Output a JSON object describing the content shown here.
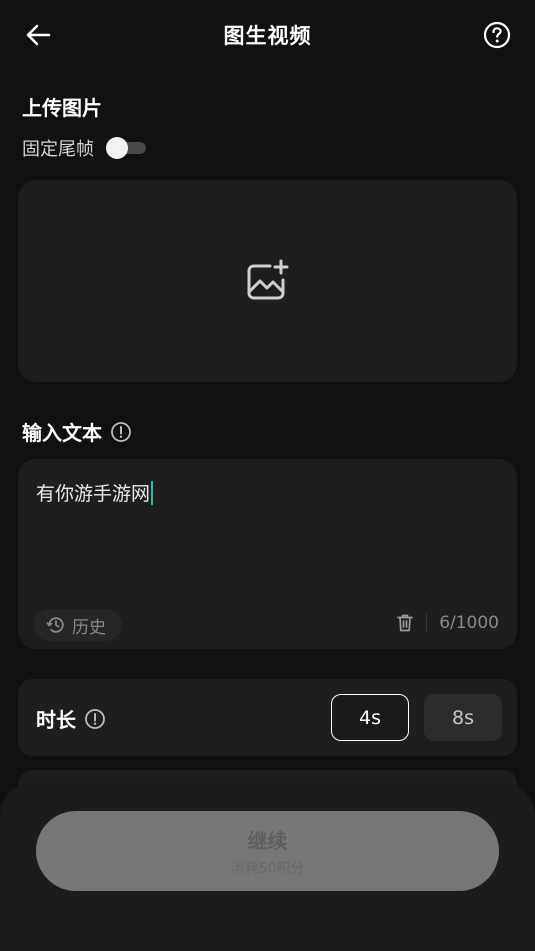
{
  "header": {
    "title": "图生视频",
    "back_icon": "arrow-left-icon",
    "help_icon": "question-circle-icon"
  },
  "upload": {
    "title": "上传图片",
    "fix_last_frame_label": "固定尾帧",
    "fix_last_frame_enabled": false,
    "add_image_icon": "image-plus-icon"
  },
  "text_input": {
    "title": "输入文本",
    "value": "有你游手游网",
    "history_label": "历史",
    "counter": "6/1000",
    "clear_icon": "trash-icon"
  },
  "duration": {
    "title": "时长",
    "options": [
      "4s",
      "8s"
    ],
    "selected": "4s"
  },
  "cta": {
    "label": "继续",
    "sublabel": "消耗50积分",
    "enabled": false
  },
  "colors": {
    "background": "#111111",
    "card": "#1e1e1e",
    "caret": "#19c3b4",
    "cta_disabled": "#777777"
  }
}
